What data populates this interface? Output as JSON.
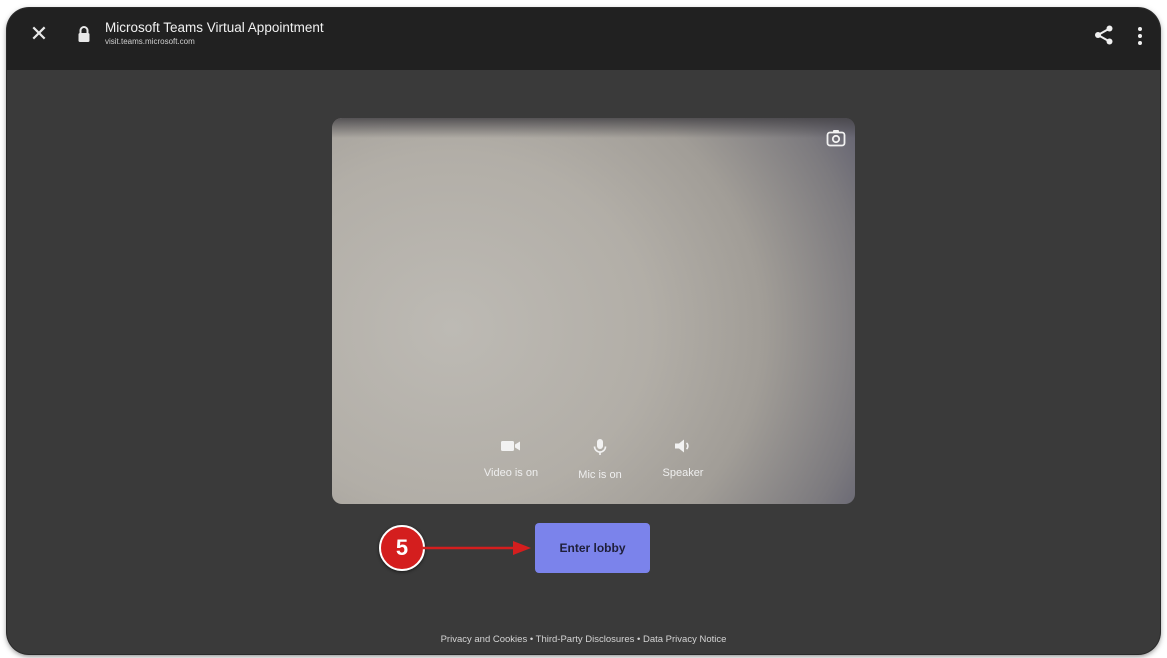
{
  "browser": {
    "title": "Microsoft Teams Virtual Appointment",
    "url": "visit.teams.microsoft.com",
    "close_icon": "close-icon",
    "lock_icon": "lock-icon",
    "share_icon": "share-icon",
    "more_icon": "more-vertical-icon"
  },
  "preview": {
    "camera_switch_icon": "camera-switch-icon",
    "controls": [
      {
        "label": "Video is on",
        "icon": "video-camera-icon"
      },
      {
        "label": "Mic is on",
        "icon": "microphone-icon"
      },
      {
        "label": "Speaker",
        "icon": "speaker-icon"
      }
    ]
  },
  "actions": {
    "enter_lobby_label": "Enter lobby",
    "accent_color": "#7b83eb"
  },
  "annotation": {
    "step_number": "5",
    "color": "#d41e1e"
  },
  "footer": {
    "links": [
      "Privacy and Cookies",
      "Third-Party Disclosures",
      "Data Privacy Notice"
    ],
    "separator": "•"
  }
}
